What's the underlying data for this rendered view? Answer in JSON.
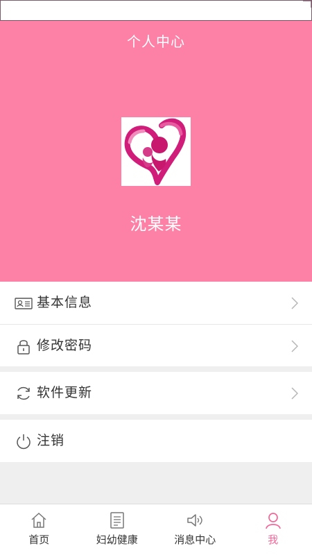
{
  "header": {
    "title": "个人中心",
    "user_name": "沈某某",
    "background_color": "#fd80a7",
    "avatar_icon": "heart-mother-child-logo"
  },
  "menu": [
    [
      {
        "label": "基本信息",
        "icon": "id-card-icon"
      },
      {
        "label": "修改密码",
        "icon": "lock-icon"
      }
    ],
    [
      {
        "label": "软件更新",
        "icon": "refresh-icon"
      }
    ],
    [
      {
        "label": "注销",
        "icon": "power-icon"
      }
    ]
  ],
  "tabbar": {
    "items": [
      {
        "label": "首页",
        "icon": "home-icon"
      },
      {
        "label": "妇幼健康",
        "icon": "list-icon"
      },
      {
        "label": "消息中心",
        "icon": "speaker-icon"
      },
      {
        "label": "我",
        "icon": "user-icon"
      }
    ],
    "active_index": 3,
    "active_color": "#f2689a"
  }
}
